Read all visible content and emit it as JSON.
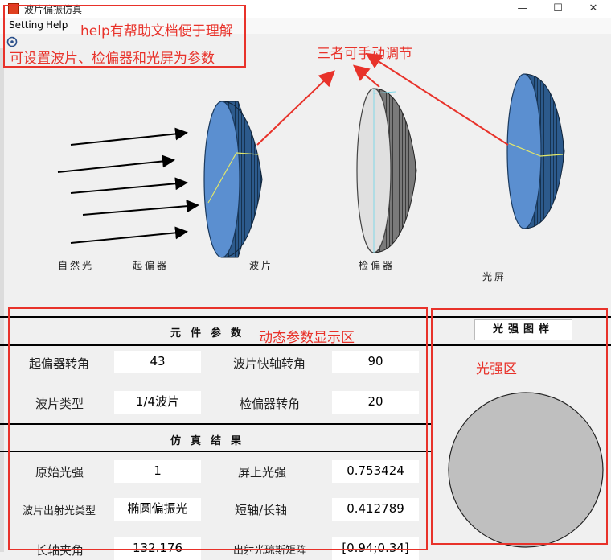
{
  "window": {
    "title": "波片偏振仿真",
    "controls": {
      "minimize": "—",
      "maximize": "☐",
      "close": "✕"
    }
  },
  "menu": {
    "setting": "Setting",
    "help": "Help"
  },
  "scene_labels": {
    "natural_light": "自然光",
    "polarizer": "起偏器",
    "wave_plate": "波片",
    "analyzer": "检偏器",
    "screen": "光屏"
  },
  "params_panel": {
    "title": "元件参数",
    "fields": [
      {
        "label": "起偏器转角",
        "value": "43"
      },
      {
        "label": "波片快轴转角",
        "value": "90"
      },
      {
        "label": "波片类型",
        "value": "1/4波片"
      },
      {
        "label": "检偏器转角",
        "value": "20"
      }
    ]
  },
  "results_panel": {
    "title": "仿真结果",
    "fields": [
      {
        "label": "原始光强",
        "value": "1"
      },
      {
        "label": "屏上光强",
        "value": "0.753424"
      },
      {
        "label": "波片出射光类型",
        "value": "椭圆偏振光"
      },
      {
        "label": "短轴/长轴",
        "value": "0.412789"
      },
      {
        "label": "长轴夹角",
        "value": "132.176"
      },
      {
        "label": "出射光琼斯矩阵",
        "value": "[0.94;0.34]"
      }
    ]
  },
  "intensity_panel": {
    "button": "光强图样"
  },
  "annotations": {
    "menu_note_1": "help有帮助文档便于理解",
    "menu_note_2": "可设置波片、检偏器和光屏为参数",
    "adjust_note": "三者可手动调节",
    "params_note": "动态参数显示区",
    "intensity_note": "光强区"
  },
  "colors": {
    "disk_face": "#5b8fd0",
    "disk_edge": "#2c5a8c",
    "analyzer_face": "#e0e0e0",
    "analyzer_edge": "#7a7a7a",
    "intensity_disk": "#bfbfbf",
    "annotation": "#e8322a"
  }
}
